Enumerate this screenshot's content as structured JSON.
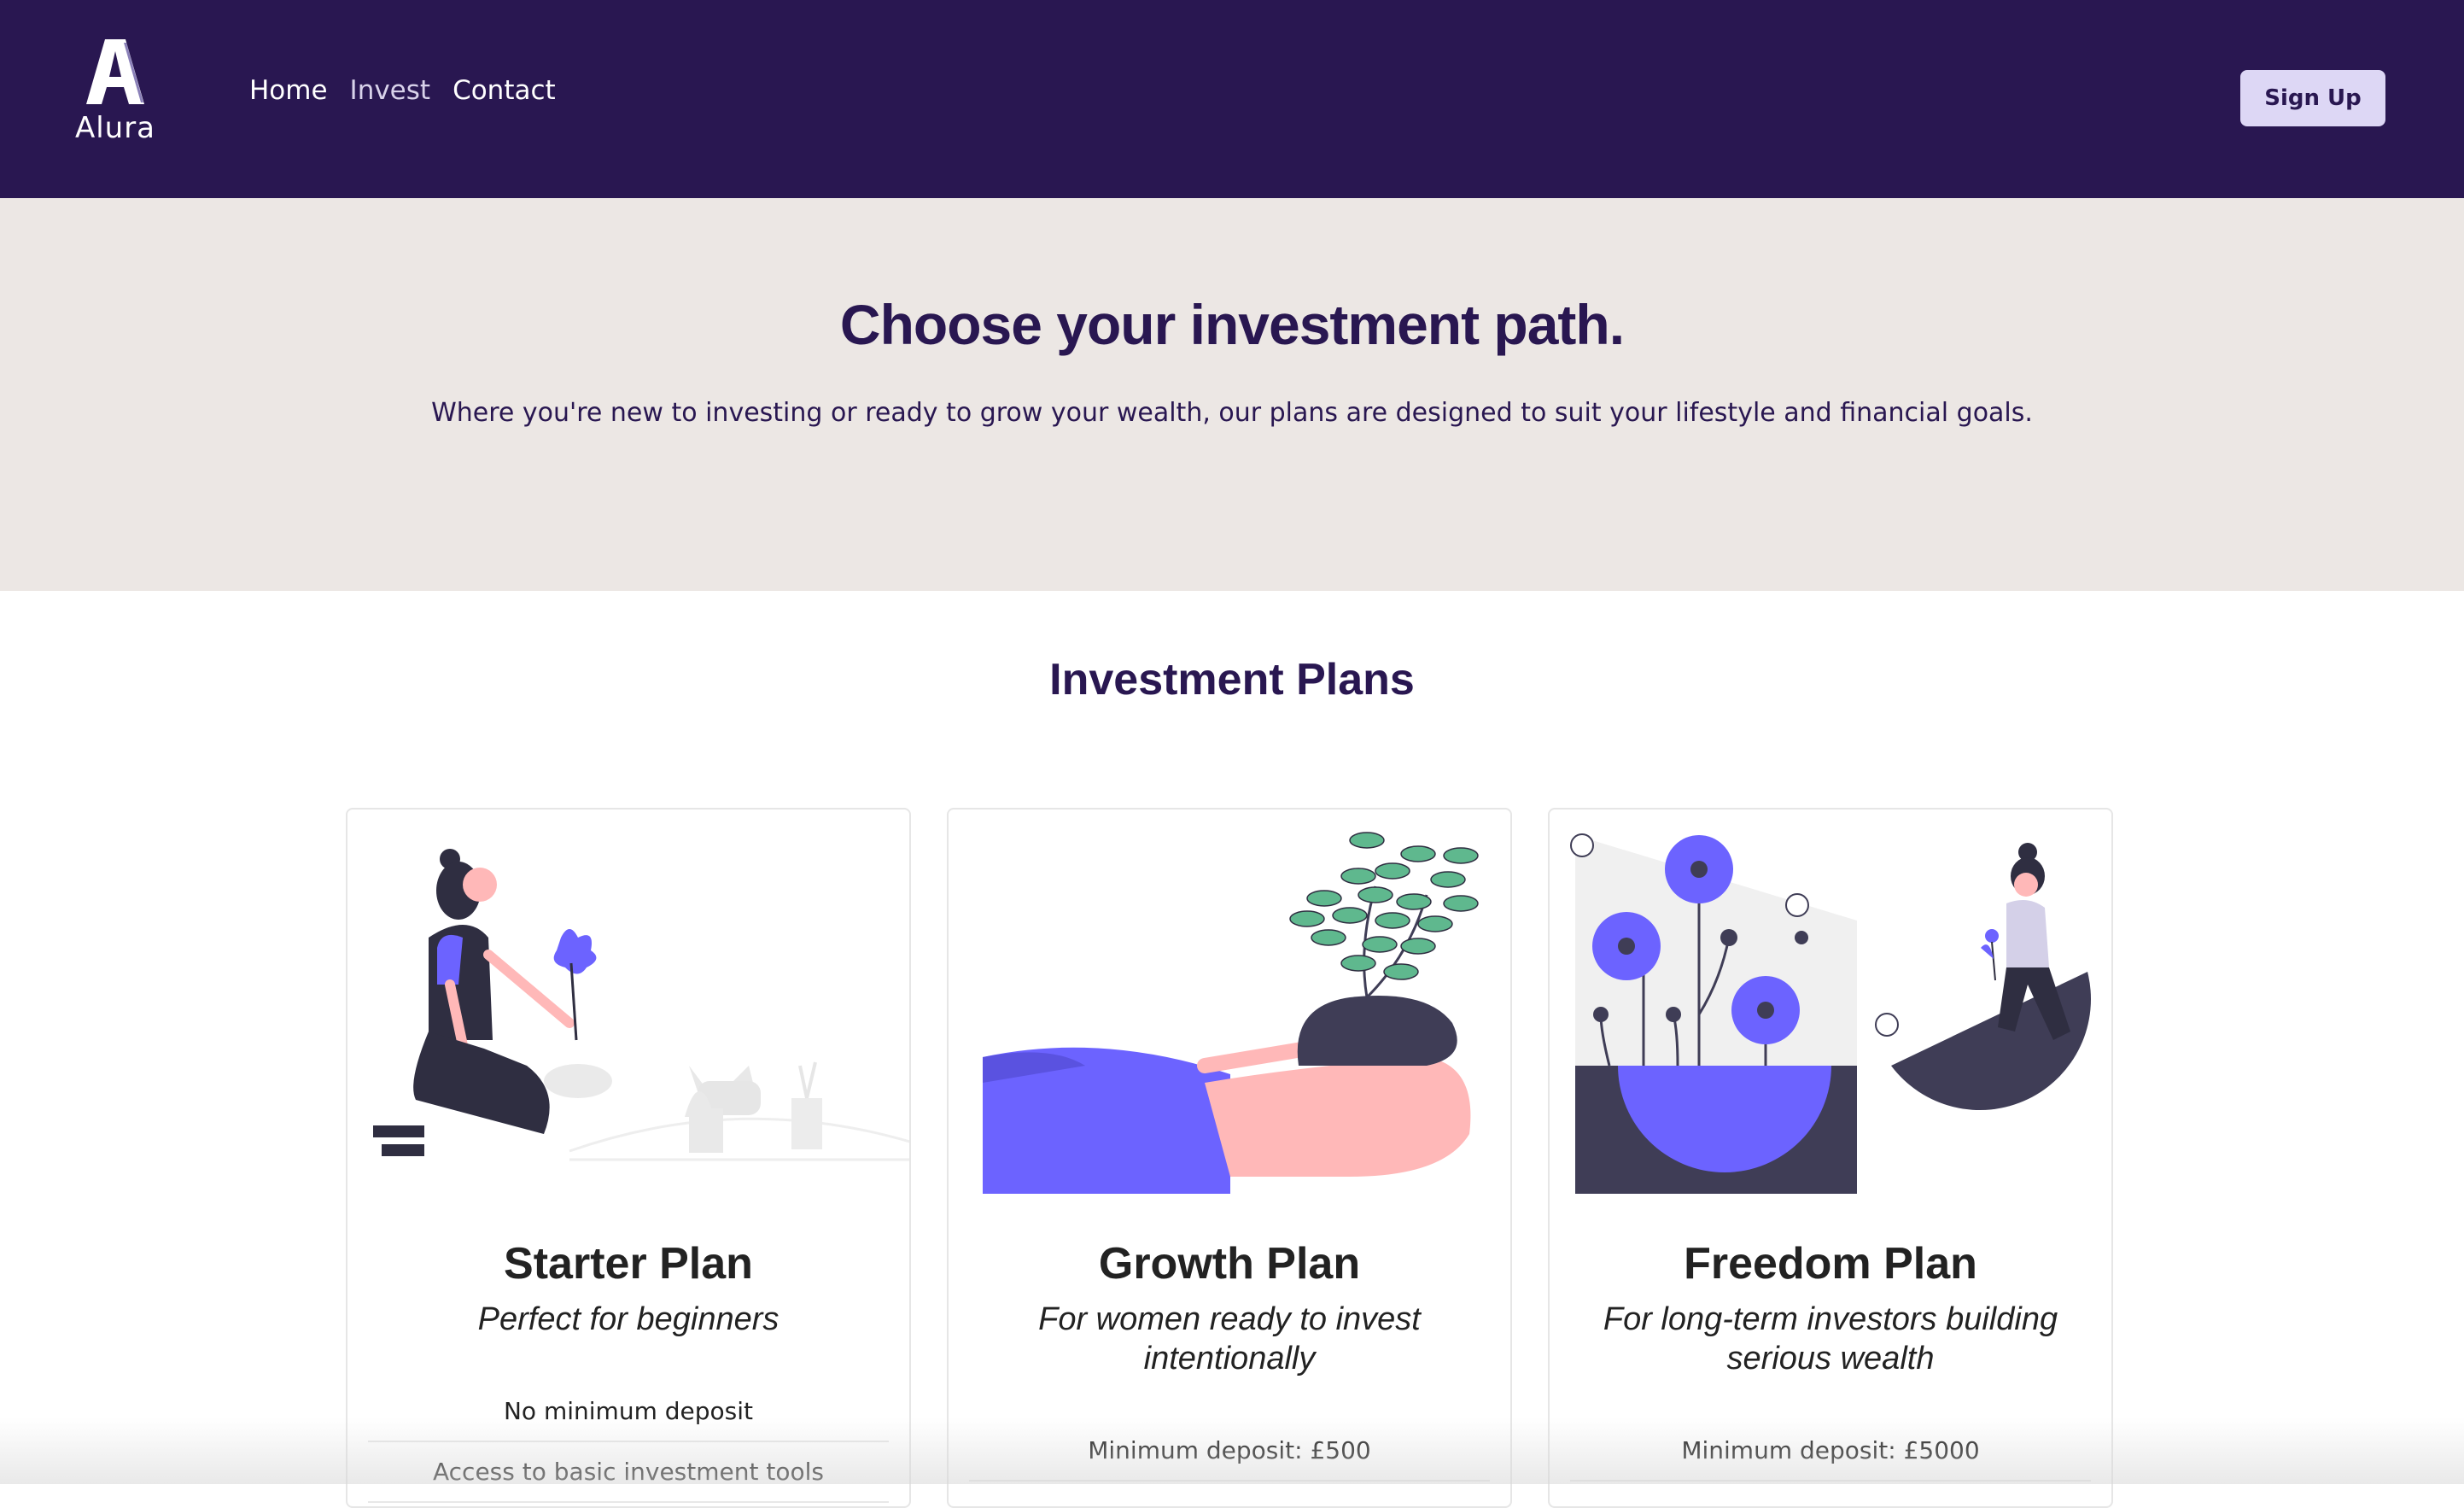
{
  "brand": {
    "name": "Alura"
  },
  "nav": {
    "items": [
      {
        "label": "Home"
      },
      {
        "label": "Invest"
      },
      {
        "label": "Contact"
      }
    ],
    "signup_label": "Sign Up"
  },
  "hero": {
    "title": "Choose your investment path.",
    "subtitle": "Where you're new to investing or ready to grow your wealth, our plans are designed to suit your lifestyle and financial goals."
  },
  "plans": {
    "heading": "Investment Plans",
    "items": [
      {
        "title": "Starter Plan",
        "subtitle": "Perfect for beginners",
        "features": [
          "No minimum deposit",
          "Access to basic investment tools"
        ]
      },
      {
        "title": "Growth Plan",
        "subtitle": "For women ready to invest intentionally",
        "features": [
          "Minimum deposit: £500"
        ]
      },
      {
        "title": "Freedom Plan",
        "subtitle": "For long-term investors building serious wealth",
        "features": [
          "Minimum deposit: £5000"
        ]
      }
    ]
  },
  "colors": {
    "primary": "#291751",
    "hero_bg": "#ece7e4",
    "accent": "#6c63ff",
    "button_bg": "#ddd7f5"
  }
}
